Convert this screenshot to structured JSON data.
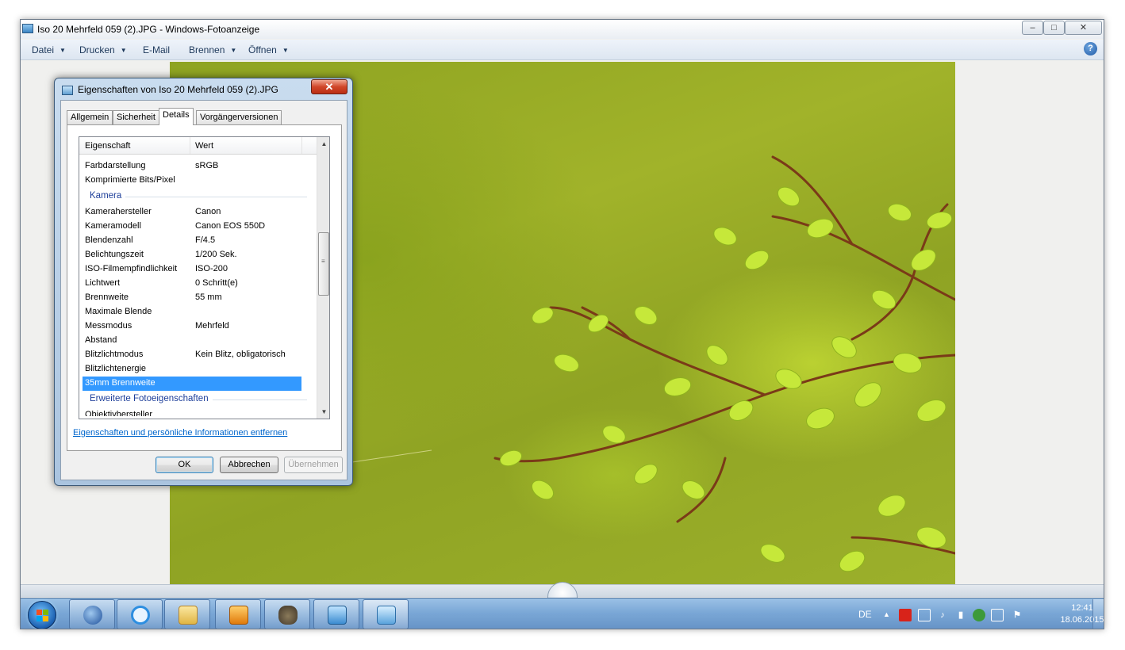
{
  "window": {
    "title": "Iso 20 Mehrfeld 059 (2).JPG - Windows-Fotoanzeige",
    "min_label": "–",
    "max_label": "□",
    "close_label": "✕"
  },
  "menu": {
    "datei": "Datei",
    "drucken": "Drucken",
    "email": "E-Mail",
    "brennen": "Brennen",
    "oeffnen": "Öffnen",
    "arrow": "▼",
    "help": "?"
  },
  "dialog": {
    "title": "Eigenschaften von Iso 20 Mehrfeld 059 (2).JPG",
    "close_label": "✕",
    "tabs": {
      "allgemein": "Allgemein",
      "sicherheit": "Sicherheit",
      "details": "Details",
      "vorgaenger": "Vorgängerversionen"
    },
    "list": {
      "col_property": "Eigenschaft",
      "col_value": "Wert",
      "rows_top": [
        {
          "k": "Farbdarstellung",
          "v": "sRGB"
        },
        {
          "k": "Komprimierte Bits/Pixel",
          "v": ""
        }
      ],
      "group_camera": "Kamera",
      "rows_camera": [
        {
          "k": "Kamerahersteller",
          "v": "Canon"
        },
        {
          "k": "Kameramodell",
          "v": "Canon EOS 550D"
        },
        {
          "k": "Blendenzahl",
          "v": "F/4.5"
        },
        {
          "k": "Belichtungszeit",
          "v": "1/200 Sek."
        },
        {
          "k": "ISO-Filmempfindlichkeit",
          "v": "ISO-200"
        },
        {
          "k": "Lichtwert",
          "v": "0 Schritt(e)"
        },
        {
          "k": "Brennweite",
          "v": "55 mm"
        },
        {
          "k": "Maximale Blende",
          "v": ""
        },
        {
          "k": "Messmodus",
          "v": "Mehrfeld"
        },
        {
          "k": "Abstand",
          "v": ""
        },
        {
          "k": "Blitzlichtmodus",
          "v": "Kein Blitz, obligatorisch"
        },
        {
          "k": "Blitzlichtenergie",
          "v": ""
        }
      ],
      "selected_row": "35mm Brennweite",
      "group_extended": "Erweiterte Fotoeigenschaften",
      "cut_row": "Objektivhersteller",
      "scroll_up": "▲",
      "scroll_down": "▼",
      "grip": "≡"
    },
    "link": "Eigenschaften und persönliche Informationen entfernen",
    "buttons": {
      "ok": "OK",
      "cancel": "Abbrechen",
      "apply": "Übernehmen"
    }
  },
  "taskbar": {
    "language": "DE",
    "tray_arrow": "▲",
    "time": "12:41",
    "date": "18.06.2015"
  },
  "colors": {
    "selection": "#3399ff",
    "link": "#0066cc",
    "group_header": "#1e3f9a",
    "taskbar": "#7aa7d6",
    "photo_green": "#9cb02b"
  }
}
